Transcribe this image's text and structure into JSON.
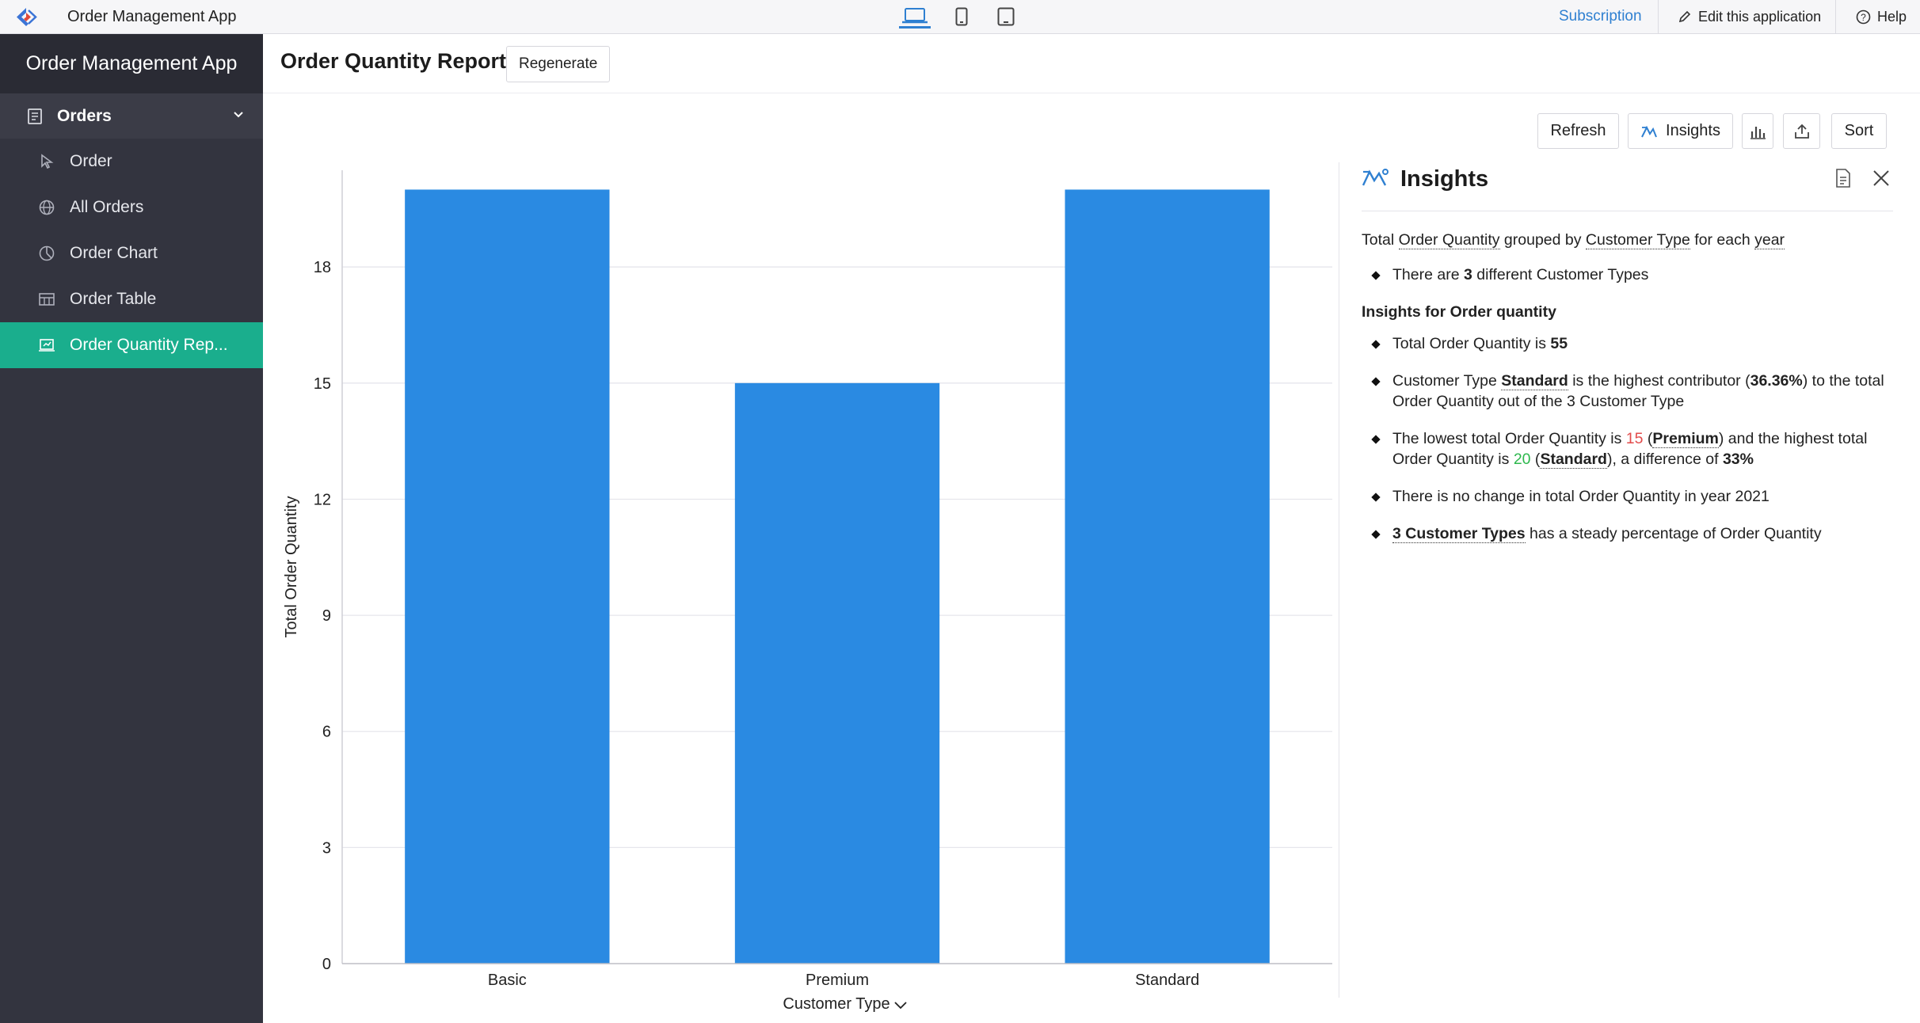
{
  "topbar": {
    "app_title": "Order Management App",
    "devices": [
      "laptop-icon",
      "mobile-icon",
      "tablet-icon"
    ],
    "subscription": "Subscription",
    "edit_app": "Edit this application",
    "help": "Help"
  },
  "sidebar": {
    "header": "Order Management App",
    "section": {
      "label": "Orders",
      "icon": "form-icon"
    },
    "items": [
      {
        "label": "Order",
        "icon": "cursor-icon"
      },
      {
        "label": "All Orders",
        "icon": "globe-icon"
      },
      {
        "label": "Order Chart",
        "icon": "pie-chart-icon"
      },
      {
        "label": "Order Table",
        "icon": "table-icon"
      },
      {
        "label": "Order Quantity Rep...",
        "icon": "report-icon",
        "active": true
      }
    ]
  },
  "page": {
    "title": "Order Quantity Report",
    "regenerate": "Regenerate"
  },
  "toolbar": {
    "refresh": "Refresh",
    "insights": "Insights",
    "sort": "Sort"
  },
  "chart_data": {
    "type": "bar",
    "categories": [
      "Basic",
      "Premium",
      "Standard"
    ],
    "values": [
      20,
      15,
      20
    ],
    "xlabel": "Customer Type",
    "ylabel": "Total Order Quantity",
    "yticks": [
      0,
      3,
      6,
      9,
      12,
      15,
      18
    ],
    "ylim": [
      0,
      20.5
    ],
    "grid": true,
    "bar_color": "#2a8ae2"
  },
  "insights": {
    "title": "Insights",
    "intro": {
      "p1": "Total ",
      "measure": "Order Quantity",
      "p2": " grouped by ",
      "dimension": "Customer Type",
      "p3": " for each ",
      "period": "year"
    },
    "count_line": {
      "p1": "There are ",
      "n": "3",
      "p2": " different Customer Types"
    },
    "subheading": "Insights for Order quantity",
    "total_line": {
      "p1": "Total Order Quantity is ",
      "value": "55"
    },
    "contrib_line": {
      "p1": "Customer Type ",
      "name": "Standard",
      "p2": " is the highest contributor (",
      "pct": "36.36%",
      "p3": ") to the total Order Quantity out of the 3 Customer Type"
    },
    "range_line": {
      "p1": "The lowest total Order Quantity is ",
      "low": "15",
      "p2": " (",
      "low_name": "Premium",
      "p3": ") and the highest total Order Quantity is ",
      "high": "20",
      "p4": " (",
      "high_name": "Standard",
      "p5": "), a difference of ",
      "diff": "33%"
    },
    "change_line": "There is no change in total Order Quantity in year 2021",
    "steady_line": {
      "link": "3 Customer Types",
      "p1": " has a steady percentage of Order Quantity"
    }
  }
}
